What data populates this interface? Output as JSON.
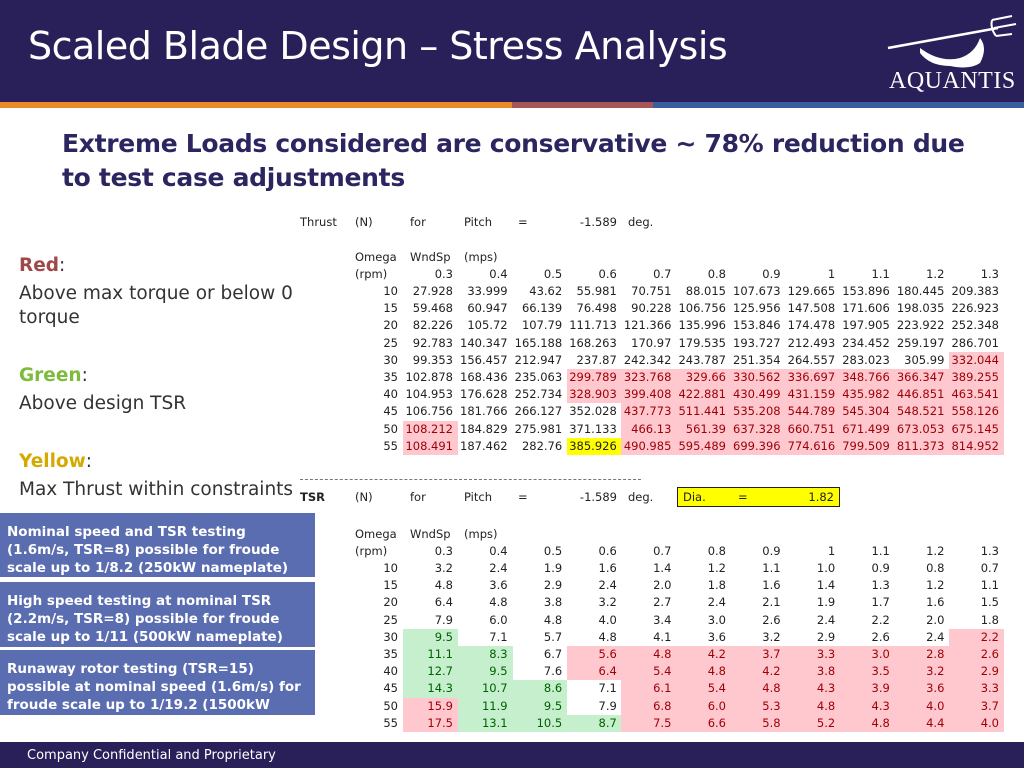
{
  "header": {
    "title": "Scaled Blade Design – Stress Analysis",
    "logo_text": "AQUANTIS",
    "stripe_colors": [
      "#e8892a",
      "#a65656",
      "#3a5f9e"
    ]
  },
  "headline": "Extreme Loads considered are conservative ~ 78% reduction due to test case adjustments",
  "legend": {
    "red_label": "Red",
    "red_text": "Above max torque or below 0 torque",
    "red_color": "#a04848",
    "green_label": "Green",
    "green_text": "Above design TSR",
    "green_color": "#7dbb3c",
    "yellow_label": "Yellow",
    "yellow_text": "Max Thrust within constraints",
    "yellow_color": "#d4aa00",
    "colon": ":"
  },
  "notes": [
    "Nominal speed and TSR testing (1.6m/s, TSR=8) possible for froude scale up to 1/8.2 (250kW nameplate)",
    "High speed testing at nominal TSR (2.2m/s, TSR=8) possible for froude scale up to 1/11 (500kW nameplate)",
    "Runaway rotor testing (TSR=15) possible at nominal speed (1.6m/s) for froude scale up to 1/19.2 (1500kW nameplate)"
  ],
  "tables": [
    {
      "caption": [
        "Thrust",
        "(N)",
        "for",
        "Pitch",
        "=",
        "-1.589",
        "deg."
      ],
      "row_header": [
        "Omega",
        "(rpm)"
      ],
      "col_header": [
        "WndSp",
        "(mps)"
      ],
      "wind_speeds": [
        "0.3",
        "0.4",
        "0.5",
        "0.6",
        "0.7",
        "0.8",
        "0.9",
        "1",
        "1.1",
        "1.2",
        "1.3"
      ],
      "omegas": [
        "10",
        "15",
        "20",
        "25",
        "30",
        "35",
        "40",
        "45",
        "50",
        "55"
      ],
      "values": [
        [
          "27.928",
          "33.999",
          "43.62",
          "55.981",
          "70.751",
          "88.015",
          "107.673",
          "129.665",
          "153.896",
          "180.445",
          "209.383"
        ],
        [
          "59.468",
          "60.947",
          "66.139",
          "76.498",
          "90.228",
          "106.756",
          "125.956",
          "147.508",
          "171.606",
          "198.035",
          "226.923"
        ],
        [
          "82.226",
          "105.72",
          "107.79",
          "111.713",
          "121.366",
          "135.996",
          "153.846",
          "174.478",
          "197.905",
          "223.922",
          "252.348"
        ],
        [
          "92.783",
          "140.347",
          "165.188",
          "168.263",
          "170.97",
          "179.535",
          "193.727",
          "212.493",
          "234.452",
          "259.197",
          "286.701"
        ],
        [
          "99.353",
          "156.457",
          "212.947",
          "237.87",
          "242.342",
          "243.787",
          "251.354",
          "264.557",
          "283.023",
          "305.99",
          "332.044"
        ],
        [
          "102.878",
          "168.436",
          "235.063",
          "299.789",
          "323.768",
          "329.66",
          "330.562",
          "336.697",
          "348.766",
          "366.347",
          "389.255"
        ],
        [
          "104.953",
          "176.628",
          "252.734",
          "328.903",
          "399.408",
          "422.881",
          "430.499",
          "431.159",
          "435.982",
          "446.851",
          "463.541"
        ],
        [
          "106.756",
          "181.766",
          "266.127",
          "352.028",
          "437.773",
          "511.441",
          "535.208",
          "544.789",
          "545.304",
          "548.521",
          "558.126"
        ],
        [
          "108.212",
          "184.829",
          "275.981",
          "371.133",
          "466.13",
          "561.39",
          "637.328",
          "660.751",
          "671.499",
          "673.053",
          "675.145"
        ],
        [
          "108.491",
          "187.462",
          "282.76",
          "385.926",
          "490.985",
          "595.489",
          "699.396",
          "774.616",
          "799.509",
          "811.373",
          "814.952"
        ]
      ],
      "highlight": [
        "...........",
        "...........",
        "...........",
        "...........",
        "..........r",
        "...rrrrrrrr",
        "...rrrrrrrr",
        "....rrrrrrr",
        "r...rrrrrrr",
        "r..yrrrrrrr"
      ]
    },
    {
      "caption": [
        "TSR",
        "(N)",
        "for",
        "Pitch",
        "=",
        "-1.589",
        "deg."
      ],
      "dia": {
        "label": "Dia.",
        "eq": "=",
        "value": "1.82"
      },
      "row_header": [
        "Omega",
        "(rpm)"
      ],
      "col_header": [
        "WndSp",
        "(mps)"
      ],
      "wind_speeds": [
        "0.3",
        "0.4",
        "0.5",
        "0.6",
        "0.7",
        "0.8",
        "0.9",
        "1",
        "1.1",
        "1.2",
        "1.3"
      ],
      "omegas": [
        "10",
        "15",
        "20",
        "25",
        "30",
        "35",
        "40",
        "45",
        "50",
        "55"
      ],
      "values": [
        [
          "3.2",
          "2.4",
          "1.9",
          "1.6",
          "1.4",
          "1.2",
          "1.1",
          "1.0",
          "0.9",
          "0.8",
          "0.7"
        ],
        [
          "4.8",
          "3.6",
          "2.9",
          "2.4",
          "2.0",
          "1.8",
          "1.6",
          "1.4",
          "1.3",
          "1.2",
          "1.1"
        ],
        [
          "6.4",
          "4.8",
          "3.8",
          "3.2",
          "2.7",
          "2.4",
          "2.1",
          "1.9",
          "1.7",
          "1.6",
          "1.5"
        ],
        [
          "7.9",
          "6.0",
          "4.8",
          "4.0",
          "3.4",
          "3.0",
          "2.6",
          "2.4",
          "2.2",
          "2.0",
          "1.8"
        ],
        [
          "9.5",
          "7.1",
          "5.7",
          "4.8",
          "4.1",
          "3.6",
          "3.2",
          "2.9",
          "2.6",
          "2.4",
          "2.2"
        ],
        [
          "11.1",
          "8.3",
          "6.7",
          "5.6",
          "4.8",
          "4.2",
          "3.7",
          "3.3",
          "3.0",
          "2.8",
          "2.6"
        ],
        [
          "12.7",
          "9.5",
          "7.6",
          "6.4",
          "5.4",
          "4.8",
          "4.2",
          "3.8",
          "3.5",
          "3.2",
          "2.9"
        ],
        [
          "14.3",
          "10.7",
          "8.6",
          "7.1",
          "6.1",
          "5.4",
          "4.8",
          "4.3",
          "3.9",
          "3.6",
          "3.3"
        ],
        [
          "15.9",
          "11.9",
          "9.5",
          "7.9",
          "6.8",
          "6.0",
          "5.3",
          "4.8",
          "4.3",
          "4.0",
          "3.7"
        ],
        [
          "17.5",
          "13.1",
          "10.5",
          "8.7",
          "7.5",
          "6.6",
          "5.8",
          "5.2",
          "4.8",
          "4.4",
          "4.0"
        ]
      ],
      "highlight": [
        "...........",
        "...........",
        "...........",
        "...........",
        "g.........r",
        "gg.rrrrrrrr",
        "gg.rrrrrrrr",
        "ggg.rrrrrrr",
        "rgg.rrrrrrr",
        "rgggrrrrrrr"
      ]
    }
  ],
  "footer": "Company Confidential and Proprietary"
}
